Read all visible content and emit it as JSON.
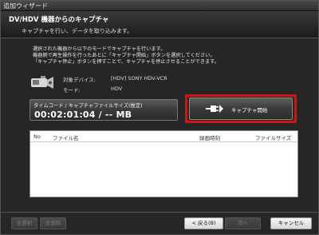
{
  "window": {
    "title": "追加ウィザード"
  },
  "header": {
    "title": "DV/HDV 機器からのキャプチャ",
    "subtitle": "キャプチャを行い、データを取り込みます。"
  },
  "instructions": {
    "line1": "選択された機器から以下のモードでキャプチャを行います。",
    "line2": "機器側で再生操作を行ったあとに「キャプチャ開始」ボタンを選択してください。",
    "line3": "「キャプチャ停止」ボタンを押すことで、キャプチャを停止させることができます。"
  },
  "device": {
    "label": "対象デバイス:",
    "value": "[HDV] SONY HDV-VCR",
    "mode_label": "モード:",
    "mode_value": "HDV",
    "icon": "camcorder-icon"
  },
  "timecode": {
    "label": "タイムコード / キャプチャファイルサイズ(推定)",
    "value": "00:02:01:04 / -- MB"
  },
  "capture_button": {
    "label": "キャプチャ開始",
    "icon": "capture-plug-icon",
    "highlight_color": "#d01515"
  },
  "table": {
    "columns": [
      "No",
      "ファイル名",
      "録画時刻",
      "ファイルサイズ"
    ],
    "rows": []
  },
  "footer": {
    "select_all_label": "全選択",
    "delete_all_label": "全削除",
    "back_label": "< 戻る(B)",
    "next_label": "次へ",
    "cancel_label": "キャンセル"
  }
}
